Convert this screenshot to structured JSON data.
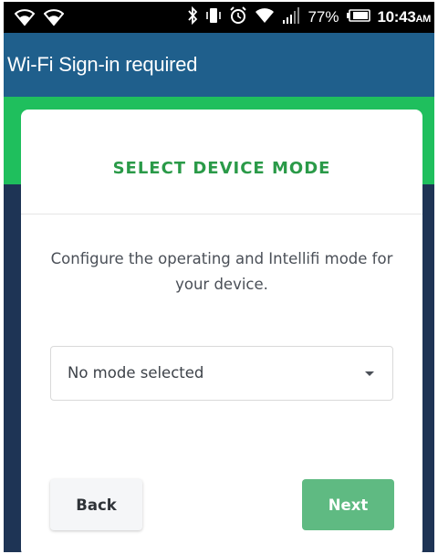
{
  "status_bar": {
    "icons_left": [
      "wifi-hotspot-icon",
      "wifi-hotspot-icon"
    ],
    "icons_right": [
      "bluetooth-icon",
      "vibrate-icon",
      "alarm-icon",
      "wifi-icon",
      "signal-icon",
      "battery-icon"
    ],
    "battery_percent": "77%",
    "time": "10:43",
    "time_suffix": "AM"
  },
  "app_bar": {
    "title": "Wi-Fi Sign-in required"
  },
  "card": {
    "title": "SELECT DEVICE MODE",
    "description": "Configure the operating and Intellifi mode for your device.",
    "mode_select": {
      "value": "No mode selected",
      "caret_icon": "caret-down-icon"
    },
    "back_label": "Back",
    "next_label": "Next"
  },
  "colors": {
    "app_bar": "#1f5f8c",
    "green_band": "#1fbf5d",
    "navy_background": "#1e3455",
    "title_green": "#2a9a48",
    "next_button": "#5fba82"
  }
}
